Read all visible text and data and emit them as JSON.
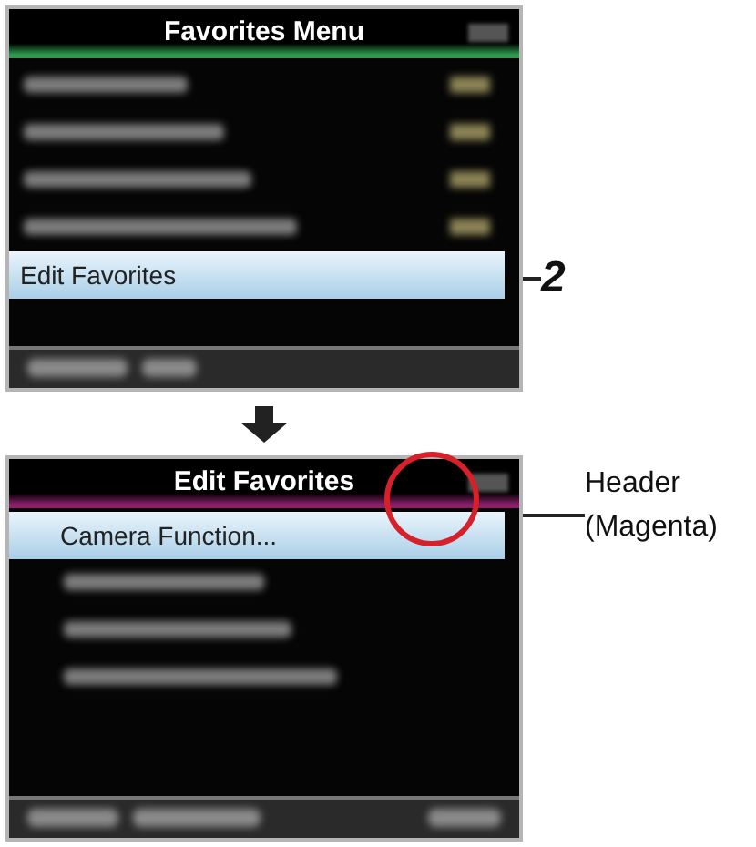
{
  "screens": [
    {
      "kind": "menu",
      "title": "Favorites Menu",
      "color": "#2f9a4e",
      "callout": {
        "kind": "step",
        "text": "2"
      },
      "items": [
        {
          "kind": "blurred_value"
        },
        {
          "kind": "blurred_value"
        },
        {
          "kind": "blurred_value"
        },
        {
          "kind": "blurred_value"
        },
        {
          "kind": "item",
          "label": "Edit Favorites",
          "selected": true
        },
        {
          "kind": "empty"
        }
      ]
    },
    {
      "kind": "edit",
      "title": "Edit Favorites",
      "color": "#8a1f6a",
      "callout": {
        "kind": "note",
        "lines": [
          "Header",
          "(Magenta)"
        ]
      },
      "items": [
        {
          "kind": "sub_item",
          "label": "Camera Function...",
          "selected": true
        },
        {
          "kind": "blurred"
        },
        {
          "kind": "blurred"
        },
        {
          "kind": "blurred"
        },
        {
          "kind": "empty"
        },
        {
          "kind": "empty"
        }
      ]
    }
  ]
}
